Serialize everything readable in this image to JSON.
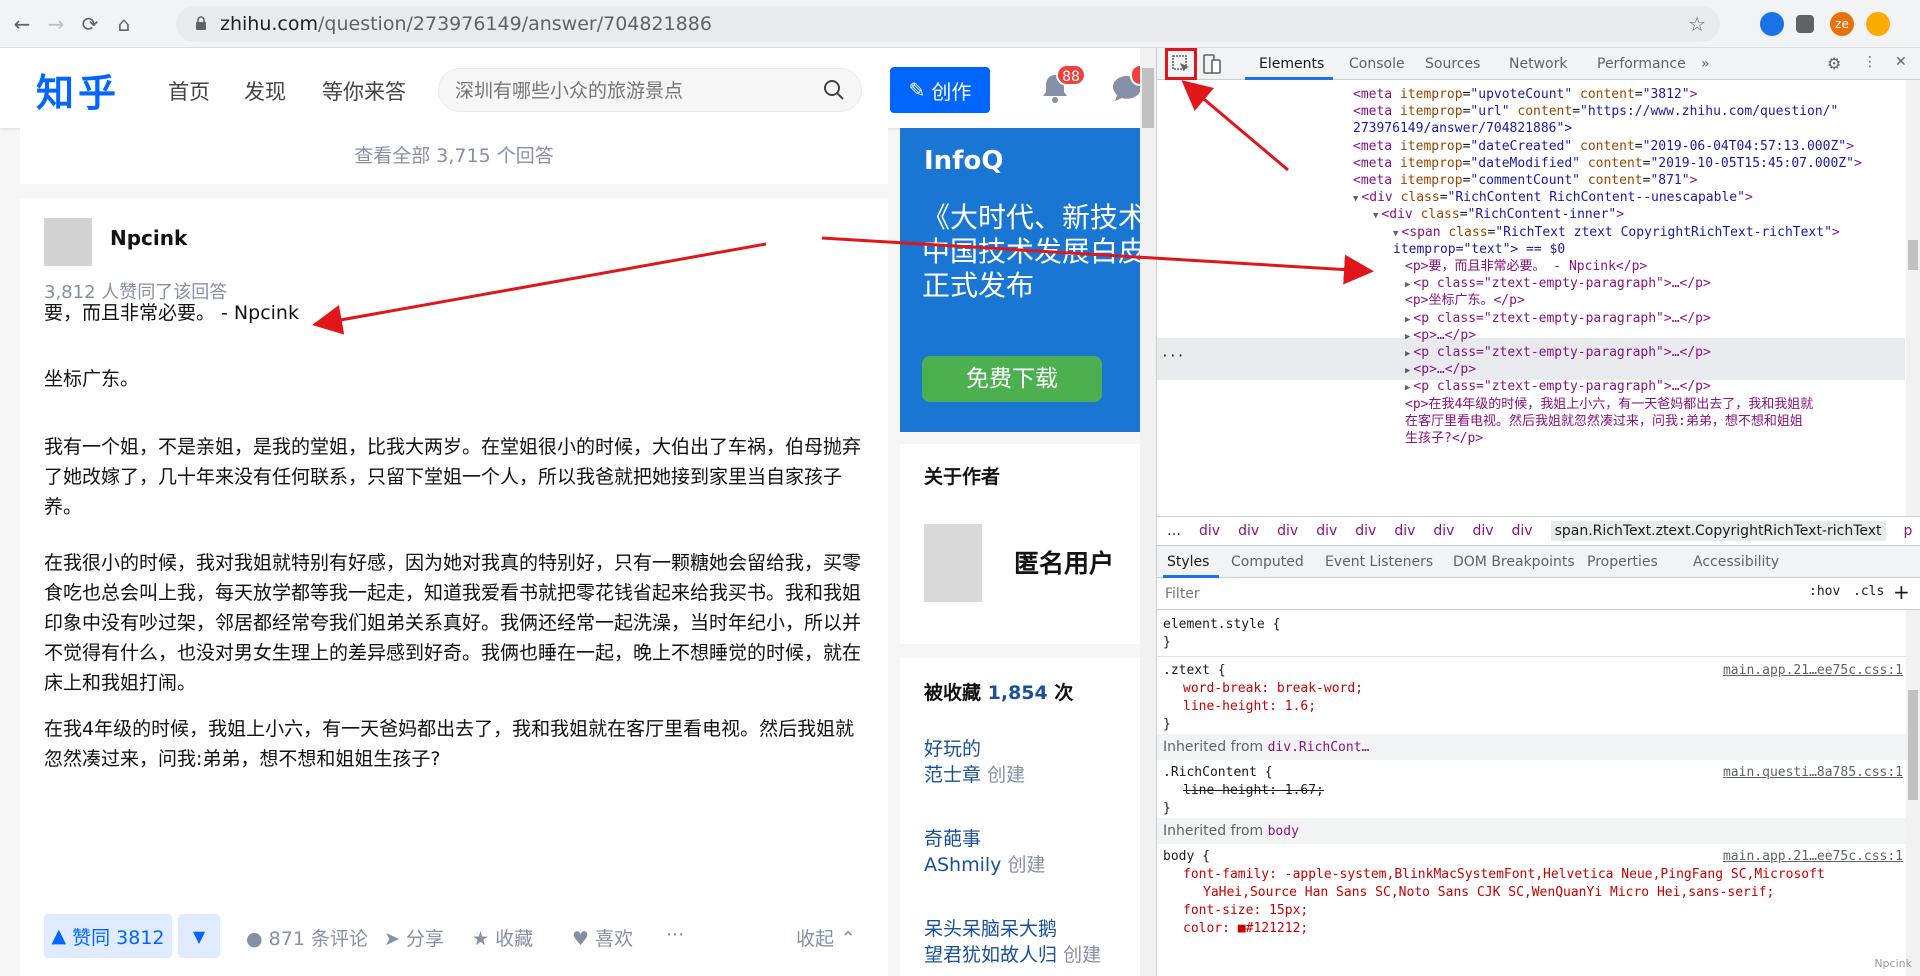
{
  "browser": {
    "url_host": "zhihu.com",
    "url_path": "/question/273976149/answer/704821886",
    "profile_initials": "ze"
  },
  "header": {
    "logo": "知乎",
    "nav": [
      "首页",
      "发现",
      "等你来答"
    ],
    "search_placeholder": "深圳有哪些小众的旅游景点",
    "create_label": "创作",
    "bell_badge": "88"
  },
  "question": {
    "view_all": "查看全部 3,715 个回答"
  },
  "answer": {
    "author_name": "Npcink",
    "upvote_info": "3,812 人赞同了该回答",
    "paragraphs": [
      "要，而且非常必要。 - Npcink",
      "坐标广东。",
      "我有一个姐，不是亲姐，是我的堂姐，比我大两岁。在堂姐很小的时候，大伯出了车祸，伯母抛弃了她改嫁了，几十年来没有任何联系，只留下堂姐一个人，所以我爸就把她接到家里当自家孩子养。",
      "在我很小的时候，我对我姐就特别有好感，因为她对我真的特别好，只有一颗糖她会留给我，买零食吃也总会叫上我，每天放学都等我一起走，知道我爱看书就把零花钱省起来给我买书。我和我姐印象中没有吵过架，邻居都经常夸我们姐弟关系真好。我俩还经常一起洗澡，当时年纪小，所以并不觉得有什么，也没对男女生理上的差异感到好奇。我俩也睡在一起，晚上不想睡觉的时候，就在床上和我姐打闹。",
      "在我4年级的时候，我姐上小六，有一天爸妈都出去了，我和我姐就在客厅里看电视。然后我姐就忽然凑过来，问我:弟弟，想不想和姐姐生孩子?"
    ],
    "actions": {
      "upvote": "赞同 3812",
      "comments": "871 条评论",
      "share": "分享",
      "favorite": "收藏",
      "like": "喜欢",
      "more": "···",
      "collapse": "收起"
    }
  },
  "sidebar": {
    "ad": {
      "logo": "InfoQ",
      "lines": [
        "《大时代、新技术",
        "中国技术发展白皮",
        "正式发布"
      ],
      "button": "免费下载"
    },
    "about_title": "关于作者",
    "about_name": "匿名用户",
    "collect_prefix": "被收藏",
    "collect_count": "1,854",
    "collect_suffix": "次",
    "collections": [
      {
        "title": "好玩的",
        "creator": "范士章",
        "created": "创建"
      },
      {
        "title": "奇葩事",
        "creator": "AShmily",
        "created": "创建"
      },
      {
        "title": "呆头呆脑呆大鹅",
        "creator": "望君犹如故人归",
        "created": "创建"
      }
    ]
  },
  "devtools": {
    "tabs": [
      "Elements",
      "Console",
      "Sources",
      "Network",
      "Performance"
    ],
    "more_tabs": "»",
    "elements": [
      {
        "indent": 0,
        "tag": "meta",
        "attrs": [
          [
            "itemprop",
            "upvoteCount"
          ],
          [
            "content",
            "3812"
          ]
        ]
      },
      {
        "indent": 0,
        "tag": "meta",
        "attrs": [
          [
            "itemprop",
            "url"
          ],
          [
            "content",
            "https://www.zhihu.com/question/"
          ]
        ]
      },
      {
        "indent": 0,
        "cont": "273976149/answer/704821886\">"
      },
      {
        "indent": 0,
        "tag": "meta",
        "attrs": [
          [
            "itemprop",
            "dateCreated"
          ],
          [
            "content",
            "2019-06-04T04:57:13.000Z"
          ]
        ]
      },
      {
        "indent": 0,
        "tag": "meta",
        "attrs": [
          [
            "itemprop",
            "dateModified"
          ],
          [
            "content",
            "2019-10-05T15:45:07.000Z"
          ]
        ]
      },
      {
        "indent": 0,
        "tag": "meta",
        "attrs": [
          [
            "itemprop",
            "commentCount"
          ],
          [
            "content",
            "871"
          ]
        ]
      },
      {
        "indent": 0,
        "open": true,
        "tag": "div",
        "attrs": [
          [
            "class",
            "RichContent RichContent--unescapable"
          ]
        ]
      },
      {
        "indent": 1,
        "open": true,
        "tag": "div",
        "attrs": [
          [
            "class",
            "RichContent-inner"
          ]
        ]
      },
      {
        "indent": 2,
        "open": true,
        "tag": "span",
        "attrs": [
          [
            "class",
            "RichText ztext CopyrightRichText-richText"
          ]
        ]
      },
      {
        "indent": 2,
        "cont": "itemprop=\"text\"> == $0"
      },
      {
        "indent": 3,
        "text": "<p>要，而且非常必要。 - Npcink</p>"
      },
      {
        "indent": 3,
        "closed": true,
        "text": "<p class=\"ztext-empty-paragraph\">…</p>"
      },
      {
        "indent": 3,
        "text": "<p>坐标广东。</p>"
      },
      {
        "indent": 3,
        "closed": true,
        "text": "<p class=\"ztext-empty-paragraph\">…</p>"
      },
      {
        "indent": 3,
        "closed": true,
        "text": "<p>…</p>"
      },
      {
        "indent": 3,
        "closed": true,
        "text": "<p class=\"ztext-empty-paragraph\">…</p>"
      },
      {
        "indent": 3,
        "closed": true,
        "text": "<p>…</p>"
      },
      {
        "indent": 3,
        "closed": true,
        "text": "<p class=\"ztext-empty-paragraph\">…</p>"
      },
      {
        "indent": 3,
        "text": "<p>在我4年级的时候，我姐上小六，有一天爸妈都出去了，我和我姐就"
      },
      {
        "indent": 3,
        "text": "在客厅里看电视。然后我姐就忽然凑过来，问我:弟弟，想不想和姐姐"
      },
      {
        "indent": 3,
        "text": "生孩子?</p>"
      }
    ],
    "breadcrumbs": [
      "…",
      "div",
      "div",
      "div",
      "div",
      "div",
      "div",
      "div",
      "div",
      "div",
      "span.RichText.ztext.CopyrightRichText-richText",
      "p"
    ],
    "sub_tabs": [
      "Styles",
      "Computed",
      "Event Listeners",
      "DOM Breakpoints",
      "Properties",
      "Accessibility"
    ],
    "filter_placeholder": "Filter",
    "hov": ":hov",
    "cls": ".cls",
    "plus": "+",
    "styles": {
      "element_style": "element.style {",
      "close": "}",
      "ztext_selector": ".ztext {",
      "ztext_src": "main.app.21…ee75c.css:1",
      "ztext_props": [
        "word-break: break-word;",
        "line-height: 1.6;"
      ],
      "inherit1_label": "Inherited from",
      "inherit1_target": "div.RichCont…",
      "rich_selector": ".RichContent {",
      "rich_src": "main.questi…8a785.css:1",
      "rich_prop": "line-height: 1.67;",
      "inherit2_label": "Inherited from",
      "inherit2_target": "body",
      "body_selector": "body {",
      "body_src": "main.app.21…ee75c.css:1",
      "body_font1": "font-family: -apple-system,BlinkMacSystemFont,Helvetica Neue,PingFang SC,Microsoft",
      "body_font2": "YaHei,Source Han Sans SC,Noto Sans CJK SC,WenQuanYi Micro Hei,sans-serif;",
      "body_size": "font-size: 15px;",
      "body_color": "color: ■#121212;"
    },
    "watermark": "Npcink"
  },
  "colors": {
    "zhihu_blue": "#0066ff",
    "badge_red": "#f1403c",
    "annotation_red": "#e0161b"
  }
}
